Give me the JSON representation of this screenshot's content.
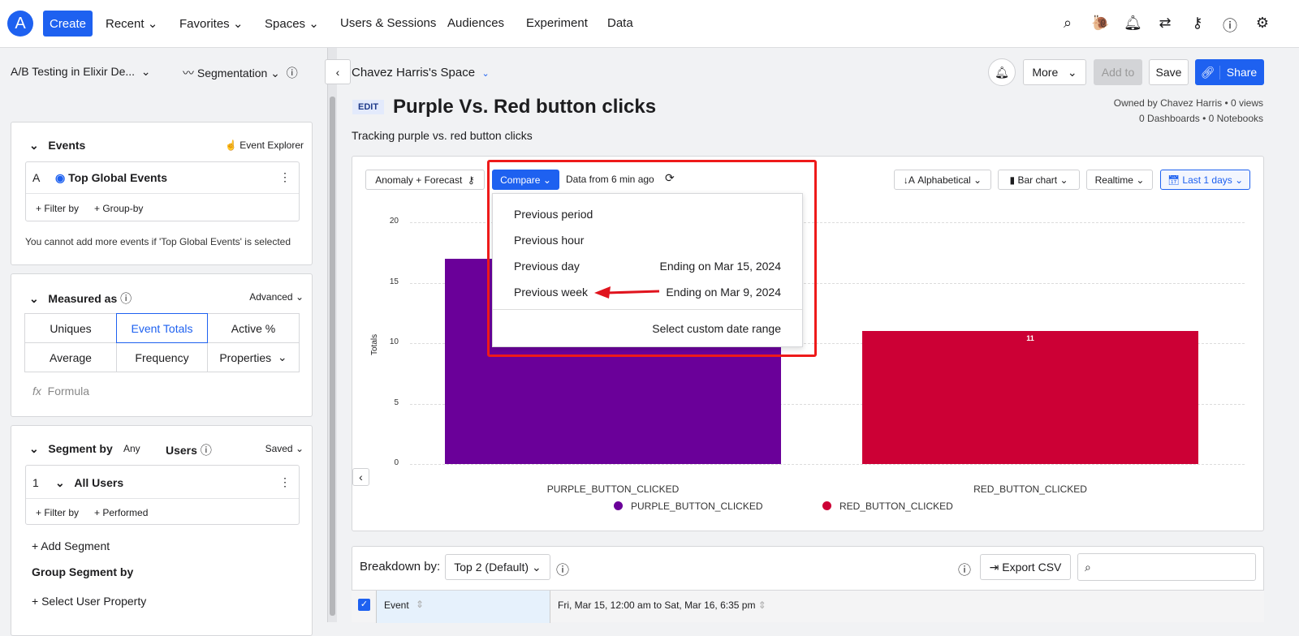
{
  "topnav": {
    "create": "Create",
    "items": [
      "Recent",
      "Favorites",
      "Spaces",
      "Users & Sessions",
      "Audiences",
      "Experiment",
      "Data"
    ],
    "icons": [
      "search-icon",
      "snail-icon",
      "bell-icon",
      "arrows-icon",
      "key-icon",
      "help-icon",
      "gear-icon"
    ]
  },
  "subheader": {
    "project": "A/B Testing in Elixir De...",
    "chart_type": "Segmentation",
    "space": "Chavez Harris's Space",
    "more": "More",
    "add_to": "Add to",
    "save": "Save",
    "share": "Share"
  },
  "chart_header": {
    "edit": "EDIT",
    "title": "Purple Vs. Red button clicks",
    "description": "Tracking purple vs. red button clicks",
    "owner": "Owned by Chavez Harris • 0 views",
    "stats": "0 Dashboards • 0 Notebooks"
  },
  "sidebar": {
    "events": {
      "title": "Events",
      "explorer": "Event Explorer",
      "letter": "A",
      "event": "Top Global Events",
      "filter": "+ Filter by",
      "group": "+ Group-by",
      "note": "You cannot add more events if 'Top Global Events' is selected"
    },
    "measured": {
      "title": "Measured as",
      "advanced": "Advanced",
      "options": [
        "Uniques",
        "Event Totals",
        "Active %",
        "Average",
        "Frequency",
        "Properties"
      ],
      "selected": "Event Totals",
      "formula": "Formula",
      "fx": "fx"
    },
    "segment": {
      "title": "Segment by",
      "any": "Any",
      "users": "Users",
      "saved": "Saved",
      "num": "1",
      "name": "All Users",
      "filter": "+ Filter by",
      "performed": "+ Performed",
      "add": "+ Add Segment",
      "group_title": "Group Segment by",
      "select_prop": "+ Select User Property"
    }
  },
  "toolbar": {
    "anomaly": "Anomaly + Forecast",
    "compare": "Compare",
    "data_from": "Data from 6 min ago",
    "sort": "Alphabetical",
    "viz": "Bar chart",
    "realtime": "Realtime",
    "range": "Last 1 days"
  },
  "compare_menu": {
    "items": [
      {
        "label": "Previous period",
        "detail": ""
      },
      {
        "label": "Previous hour",
        "detail": ""
      },
      {
        "label": "Previous day",
        "detail": "Ending on Mar 15, 2024"
      },
      {
        "label": "Previous week",
        "detail": "Ending on Mar 9, 2024"
      }
    ],
    "custom": "Select custom date range"
  },
  "chart_data": {
    "type": "bar",
    "categories": [
      "PURPLE_BUTTON_CLICKED",
      "RED_BUTTON_CLICKED"
    ],
    "values": [
      17,
      11
    ],
    "colors": [
      "#6a0099",
      "#cc0035"
    ],
    "data_labels": [
      "",
      "11"
    ],
    "ylabel": "Totals",
    "ylim": [
      0,
      20
    ],
    "yticks": [
      "0",
      "5",
      "10",
      "15",
      "20"
    ],
    "grid": true,
    "legend": "bottom"
  },
  "breakdown": {
    "label": "Breakdown by:",
    "select": "Top 2 (Default)",
    "export": "Export CSV",
    "col_event": "Event",
    "col_range": "Fri, Mar 15, 12:00 am to Sat, Mar 16, 6:35 pm"
  }
}
